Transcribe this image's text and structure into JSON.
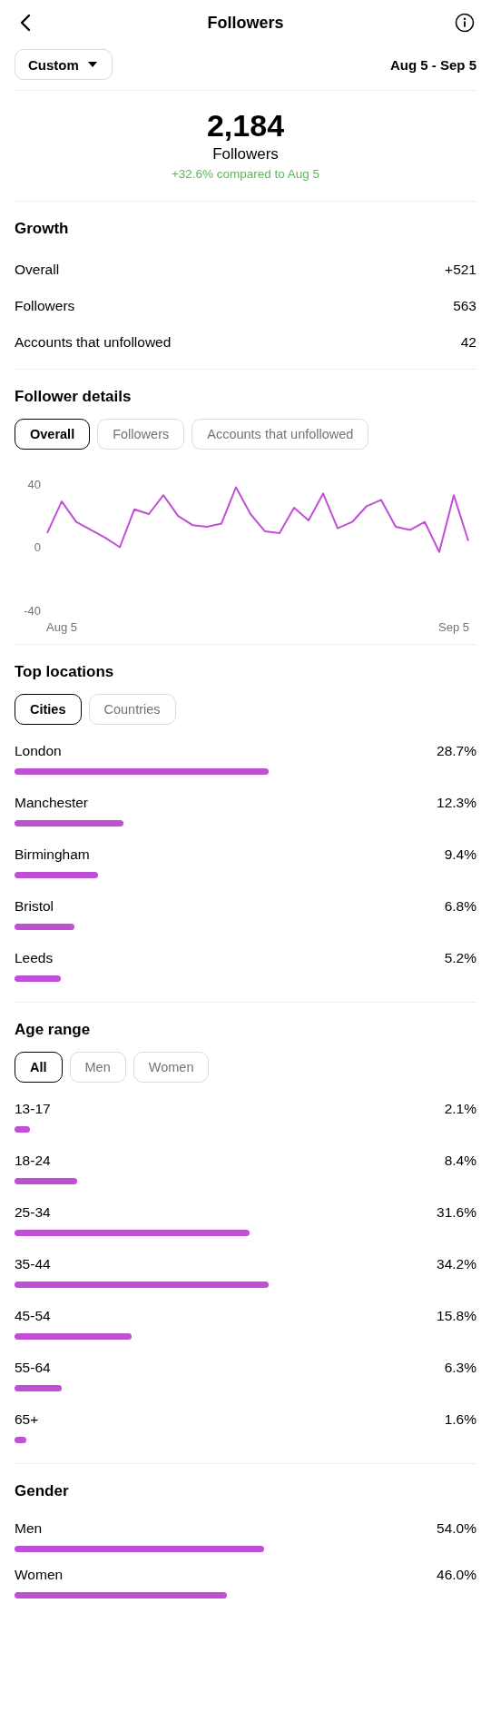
{
  "header": {
    "title": "Followers"
  },
  "range": {
    "dropdown": "Custom",
    "dates": "Aug 5 - Sep 5"
  },
  "summary": {
    "count": "2,184",
    "label": "Followers",
    "change": "+32.6% compared to Aug 5"
  },
  "growth": {
    "title": "Growth",
    "rows": [
      {
        "label": "Overall",
        "value": "+521"
      },
      {
        "label": "Followers",
        "value": "563"
      },
      {
        "label": "Accounts that unfollowed",
        "value": "42"
      }
    ]
  },
  "follower_details": {
    "title": "Follower details",
    "tabs": [
      {
        "label": "Overall",
        "selected": true
      },
      {
        "label": "Followers",
        "selected": false
      },
      {
        "label": "Accounts that unfollowed",
        "selected": false
      }
    ],
    "chart_data": {
      "type": "line",
      "categories": [
        null,
        "Aug 5",
        null,
        null,
        null,
        null,
        null,
        null,
        null,
        null,
        null,
        null,
        null,
        null,
        null,
        null,
        null,
        null,
        null,
        null,
        null,
        null,
        null,
        null,
        null,
        null,
        null,
        null,
        "Sep 5",
        null
      ],
      "series": [
        {
          "color": "#c14fd6",
          "values": [
            9,
            29,
            16,
            11,
            6,
            0,
            24,
            21,
            33,
            20,
            14,
            13,
            15,
            38,
            21,
            10,
            9,
            25,
            17,
            34,
            12,
            16,
            26,
            30,
            13,
            11,
            16,
            -3,
            33,
            4
          ]
        }
      ],
      "ylim": [
        -40,
        40
      ],
      "yticks": [
        40,
        0,
        -40
      ]
    }
  },
  "top_locations": {
    "title": "Top locations",
    "tabs": [
      {
        "label": "Cities",
        "selected": true
      },
      {
        "label": "Countries",
        "selected": false
      }
    ],
    "rows": [
      {
        "label": "London",
        "value": "28.7%"
      },
      {
        "label": "Manchester",
        "value": "12.3%"
      },
      {
        "label": "Birmingham",
        "value": "9.4%"
      },
      {
        "label": "Bristol",
        "value": "6.8%"
      },
      {
        "label": "Leeds",
        "value": "5.2%"
      }
    ]
  },
  "age_range": {
    "title": "Age range",
    "tabs": [
      {
        "label": "All",
        "selected": true
      },
      {
        "label": "Men",
        "selected": false
      },
      {
        "label": "Women",
        "selected": false
      }
    ],
    "rows": [
      {
        "label": "13-17",
        "value": "2.1%"
      },
      {
        "label": "18-24",
        "value": "8.4%"
      },
      {
        "label": "25-34",
        "value": "31.6%"
      },
      {
        "label": "35-44",
        "value": "34.2%"
      },
      {
        "label": "45-54",
        "value": "15.8%"
      },
      {
        "label": "55-64",
        "value": "6.3%"
      },
      {
        "label": "65+",
        "value": "1.6%"
      }
    ]
  },
  "gender": {
    "title": "Gender",
    "rows": [
      {
        "label": "Men",
        "value": "54.0%"
      },
      {
        "label": "Women",
        "value": "46.0%"
      }
    ]
  }
}
